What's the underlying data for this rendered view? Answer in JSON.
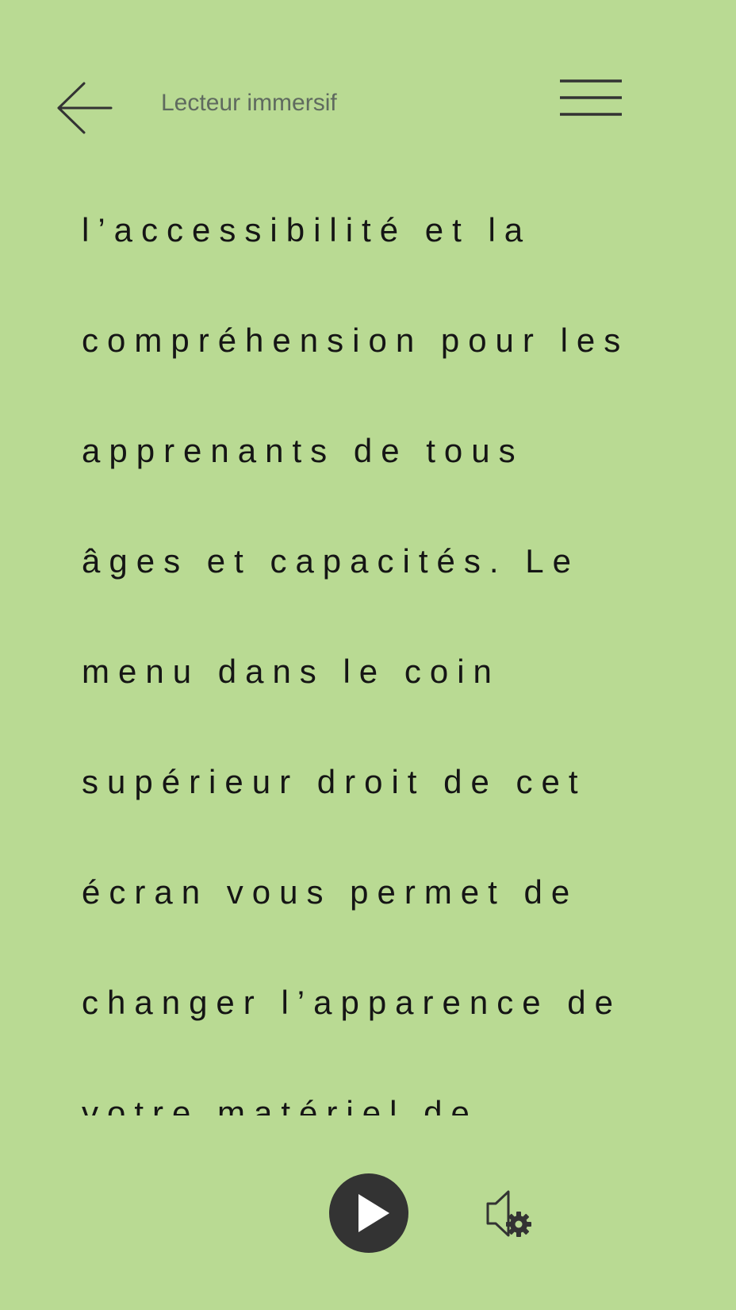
{
  "header": {
    "title": "Lecteur immersif",
    "back_icon": "arrow-left-icon",
    "menu_icon": "hamburger-menu-icon"
  },
  "reading": {
    "lines": [
      "l’accessibilité et la",
      "compréhension pour les",
      "apprenants de tous",
      "âges et capacités. Le",
      "menu dans le coin",
      "supérieur droit de cet",
      "écran vous permet de",
      "changer l’apparence de",
      "votre matériel de"
    ]
  },
  "player": {
    "play_icon": "play-icon",
    "voice_settings_icon": "speaker-gear-icon"
  },
  "colors": {
    "background": "#b9da93",
    "text": "#151515",
    "title": "#5f6a5f",
    "icon": "#333333"
  }
}
